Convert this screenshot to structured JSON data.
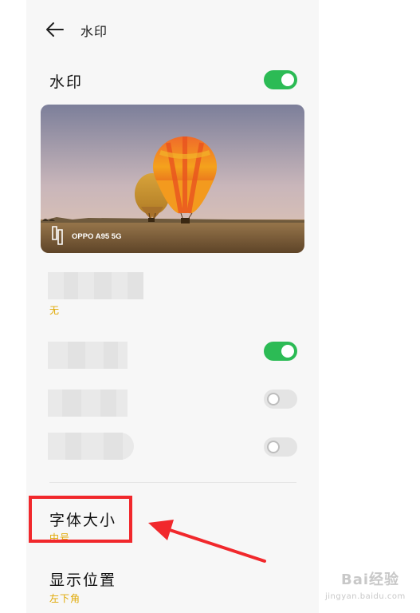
{
  "header": {
    "title": "水印"
  },
  "watermark_row": {
    "title": "水印",
    "toggle_on": true
  },
  "preview": {
    "device_label": "OPPO A95 5G"
  },
  "hidden_rows": [
    {
      "subtitle": "无"
    },
    {
      "toggle_on": true
    },
    {
      "toggle_on": false
    },
    {
      "toggle_on": false
    }
  ],
  "font_size": {
    "title": "字体大小",
    "value": "中号"
  },
  "position": {
    "title": "显示位置",
    "value": "左下角"
  },
  "site_watermark": {
    "brand": "Bai经验",
    "url": "jingyan.baidu.com"
  },
  "colors": {
    "accent": "#2cbb55",
    "value": "#e0a800",
    "annotation": "#f1282c"
  }
}
